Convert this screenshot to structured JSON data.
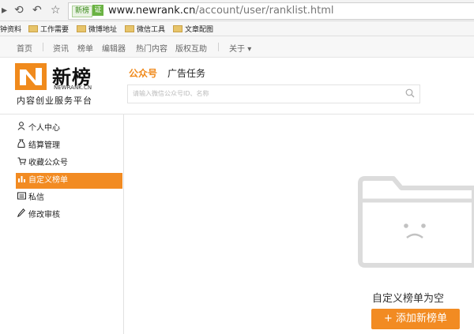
{
  "browser": {
    "site_badge": "新榜",
    "cert_label": "证",
    "url_host": "www.newrank.cn",
    "url_path": "/account/user/ranklist.html",
    "icons": [
      "arrow-right-icon",
      "refresh-icon",
      "back-icon",
      "star-icon"
    ]
  },
  "bookmarks": {
    "items": [
      {
        "label": "钟资料"
      },
      {
        "label": "工作需要"
      },
      {
        "label": "微博地址"
      },
      {
        "label": "微信工具"
      },
      {
        "label": "文章配图"
      }
    ]
  },
  "sitenav": {
    "items": [
      {
        "label": "首页"
      },
      {
        "label": "资讯"
      },
      {
        "label": "榜单"
      },
      {
        "label": "编辑器"
      },
      {
        "label": "热门内容"
      },
      {
        "label": "版权互助"
      },
      {
        "label": "关于"
      }
    ],
    "dropdown_glyph": "▾"
  },
  "header": {
    "logo_name": "新榜",
    "logo_sub": "NEWRANK.CN",
    "slogan": "内容创业服务平台",
    "tabs": [
      {
        "label": "公众号"
      },
      {
        "label": "广告任务"
      }
    ],
    "search_placeholder": "请输入微信公众号ID、名称"
  },
  "sidebar": {
    "items": [
      {
        "label": "个人中心",
        "icon": "user-icon"
      },
      {
        "label": "结算管理",
        "icon": "money-bag-icon"
      },
      {
        "label": "收藏公众号",
        "icon": "cart-icon"
      },
      {
        "label": "自定义榜单",
        "icon": "bar-chart-icon",
        "active": true
      },
      {
        "label": "私信",
        "icon": "message-icon"
      },
      {
        "label": "修改审核",
        "icon": "pencil-icon"
      }
    ]
  },
  "main": {
    "empty_text": "自定义榜单为空",
    "add_button_label": "+ 添加新榜单"
  },
  "colors": {
    "accent": "#f28b22",
    "border": "#e1e1e1"
  }
}
